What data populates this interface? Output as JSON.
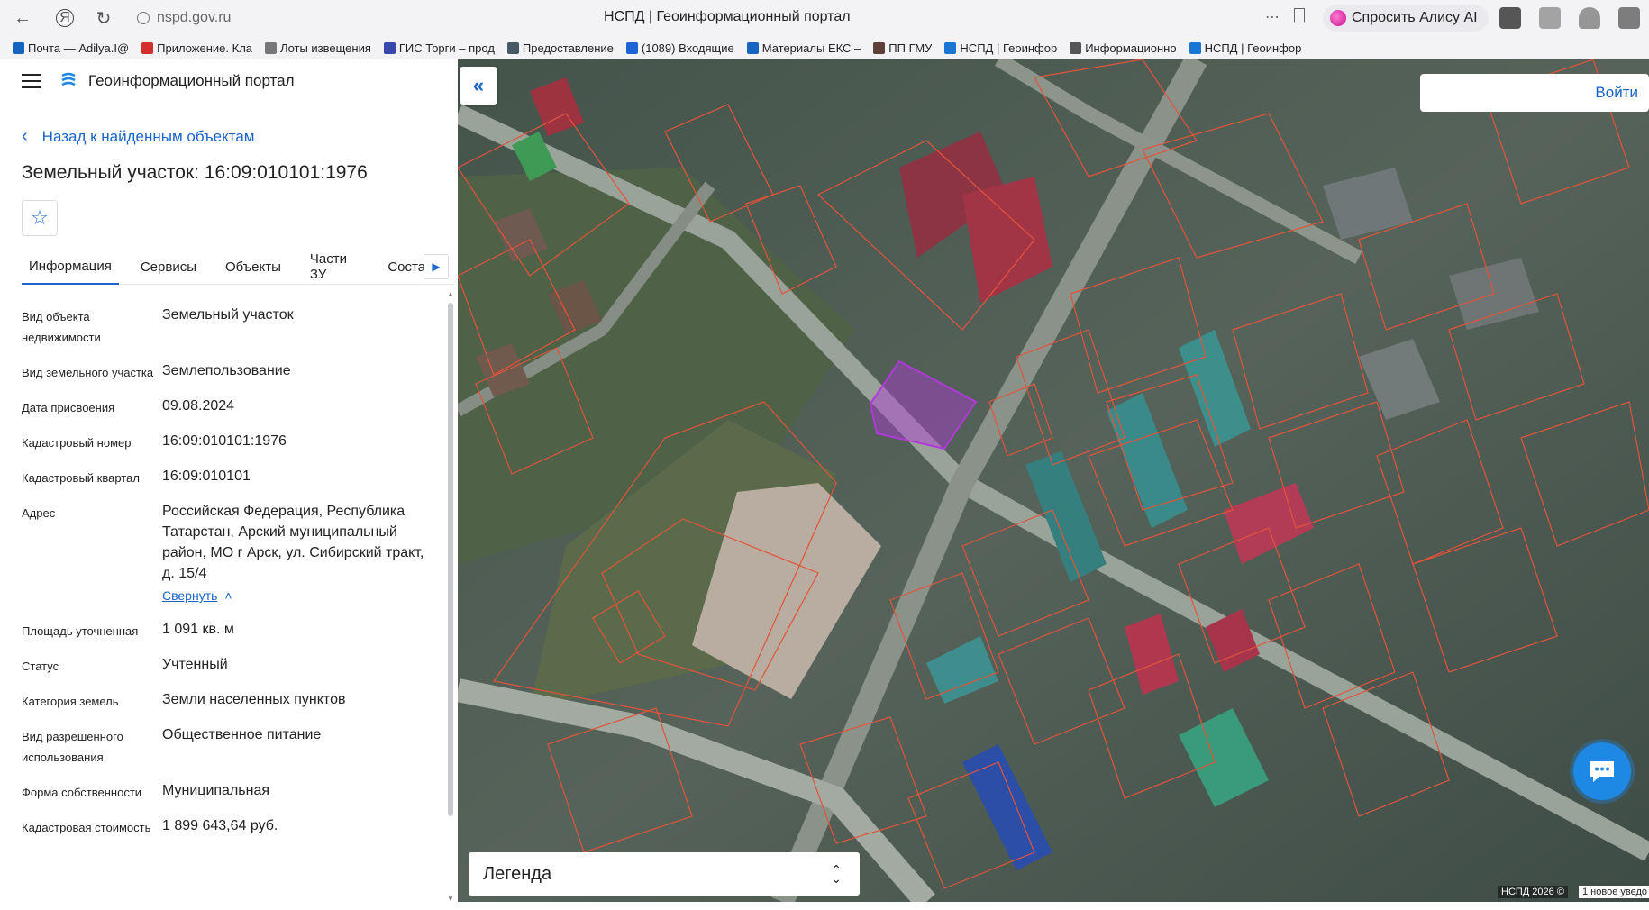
{
  "browser": {
    "url": "nspd.gov.ru",
    "tab_title": "НСПД | Геоинформационный портал",
    "alice_label": "Спросить Алису AI"
  },
  "bookmarks": [
    {
      "label": "Почта — Adilya.I@",
      "color": "#1565c0"
    },
    {
      "label": "Приложение. Кла",
      "color": "#d32f2f"
    },
    {
      "label": "Лоты извещения",
      "color": "#777777"
    },
    {
      "label": "ГИС Торги – прод",
      "color": "#3949ab"
    },
    {
      "label": "Предоставление",
      "color": "#455a64"
    },
    {
      "label": "(1089) Входящие",
      "color": "#1e63d6"
    },
    {
      "label": "Материалы ЕКС –",
      "color": "#1565c0"
    },
    {
      "label": "ПП ГМУ",
      "color": "#5d4037"
    },
    {
      "label": "НСПД | Геоинфор",
      "color": "#1976d2"
    },
    {
      "label": "Информационно",
      "color": "#555555"
    },
    {
      "label": "НСПД | Геоинфор",
      "color": "#1976d2"
    }
  ],
  "panel": {
    "portal_name": "Геоинформационный портал",
    "back_label": "Назад к найденным объектам",
    "title": "Земельный участок: 16:09:010101:1976",
    "tabs": [
      "Информация",
      "Сервисы",
      "Объекты",
      "Части ЗУ",
      "Состав"
    ],
    "active_tab": "Информация",
    "collapse_label": "Свернуть",
    "fields": [
      {
        "key": "Вид объекта недвижимости",
        "value": "Земельный участок"
      },
      {
        "key": "Вид земельного участка",
        "value": "Землепользование"
      },
      {
        "key": "Дата присвоения",
        "value": "09.08.2024"
      },
      {
        "key": "Кадастровый номер",
        "value": "16:09:010101:1976"
      },
      {
        "key": "Кадастровый квартал",
        "value": "16:09:010101"
      },
      {
        "key": "Адрес",
        "value": "Российская Федерация, Республика Татарстан, Арский муниципальный район, МО г Арск, ул. Сибирский тракт, д. 15/4"
      },
      {
        "key": "Площадь уточненная",
        "value": "1 091 кв. м"
      },
      {
        "key": "Статус",
        "value": "Учтенный"
      },
      {
        "key": "Категория земель",
        "value": "Земли населенных пунктов"
      },
      {
        "key": "Вид разрешенного использования",
        "value": "Общественное питание"
      },
      {
        "key": "Форма собственности",
        "value": "Муниципальная"
      },
      {
        "key": "Кадастровая стоимость",
        "value": "1 899 643,64 руб."
      }
    ]
  },
  "map": {
    "login_label": "Войти",
    "legend_label": "Легенда",
    "copyright": "НСПД 2026 ©",
    "notification": "1 новое уведо",
    "selected_parcel_color": "#b03ad8",
    "boundary_color": "#e2543a"
  }
}
